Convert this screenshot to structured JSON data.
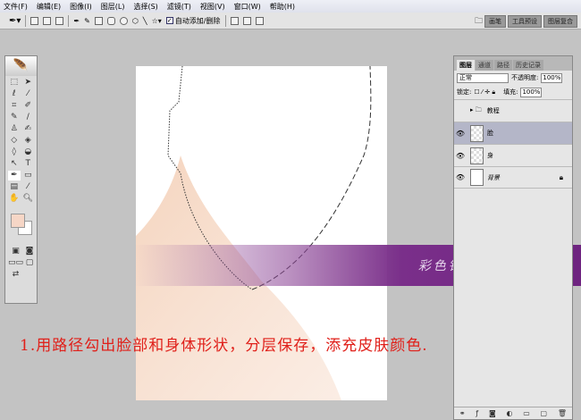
{
  "menu": [
    "文件(F)",
    "编辑(E)",
    "图像(I)",
    "图层(L)",
    "选择(S)",
    "滤镜(T)",
    "视图(V)",
    "窗口(W)",
    "帮助(H)"
  ],
  "options": {
    "auto_add_delete_label": "自动添加/删除",
    "auto_add_delete_checked": true
  },
  "palette_wells": [
    "画笔",
    "工具预设",
    "图层复合"
  ],
  "toolbox": {
    "foreground_color": "#f6d6c6",
    "background_color": "#ffffff"
  },
  "layers_panel": {
    "tabs": [
      "图层",
      "通道",
      "路径",
      "历史记录"
    ],
    "active_tab": "图层",
    "blend_mode": "正常",
    "opacity_label": "不透明度:",
    "opacity": "100%",
    "lock_label": "锁定:",
    "fill_label": "填充:",
    "fill": "100%",
    "layers": [
      {
        "name": "教程",
        "type": "group",
        "visible": false
      },
      {
        "name": "脸",
        "visible": true,
        "selected": true
      },
      {
        "name": "身",
        "visible": true
      },
      {
        "name": "背景",
        "visible": true,
        "locked": true
      }
    ]
  },
  "banner_text": "彩色铅笔-靖 原创教程",
  "instruction": "1.用路径勾出脸部和身体形状，分层保存，添充皮肤颜色."
}
